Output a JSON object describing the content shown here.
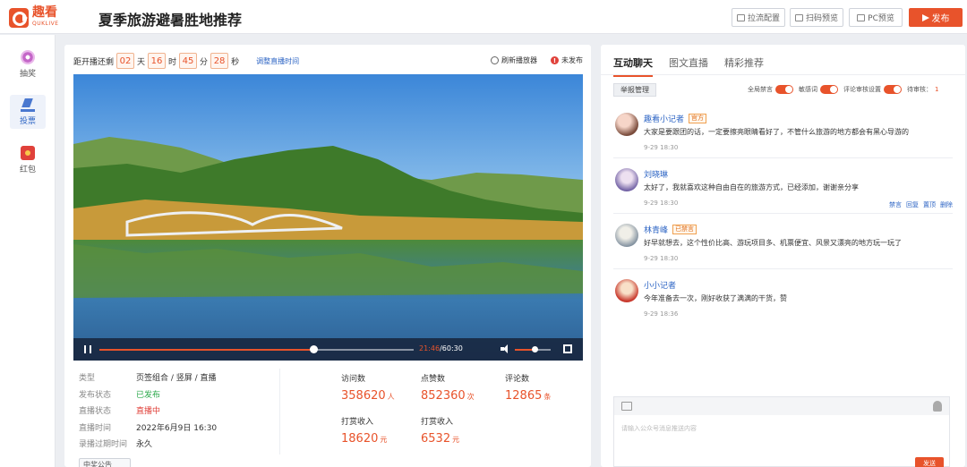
{
  "header": {
    "logo_cn": "趣看",
    "logo_en": "QUKLIVE",
    "title": "夏季旅游避暑胜地推荐",
    "btn_config": "拉流配置",
    "btn_scan": "扫码预览",
    "btn_pc": "PC预览",
    "btn_publish": "发布"
  },
  "sidebar": {
    "items": [
      {
        "label": "抽奖"
      },
      {
        "label": "投票"
      },
      {
        "label": "红包"
      }
    ]
  },
  "countdown": {
    "prefix": "距开播还剩",
    "days": "02",
    "days_unit": "天",
    "hours": "16",
    "hours_unit": "时",
    "minutes": "45",
    "minutes_unit": "分",
    "seconds": "28",
    "seconds_unit": "秒",
    "adjust": "调整直播时间"
  },
  "player_status": {
    "refresh": "刷新播放器",
    "unpublished": "未发布",
    "unpublished_mark": "!"
  },
  "player": {
    "current": "21:46",
    "total": "/60:30",
    "progress": 0.68,
    "volume": 0.55
  },
  "details": [
    {
      "k": "类型",
      "v": "页签组合 / 竖屏 / 直播"
    },
    {
      "k": "发布状态",
      "v": "已发布"
    },
    {
      "k": "直播状态",
      "v": "直播中"
    },
    {
      "k": "直播时间",
      "v": "2022年6月9日  16:30"
    },
    {
      "k": "录播过期时间",
      "v": "永久"
    }
  ],
  "stats": [
    {
      "label": "访问数",
      "num": "358620",
      "unit": "人"
    },
    {
      "label": "点赞数",
      "num": "852360",
      "unit": "次"
    },
    {
      "label": "评论数",
      "num": "12865",
      "unit": "条"
    },
    {
      "label": "打赏收入",
      "num": "18620",
      "unit": "元"
    },
    {
      "label": "打赏收入",
      "num": "6532",
      "unit": "元"
    }
  ],
  "slot_button": "中奖公告",
  "chat": {
    "tabs": [
      "互动聊天",
      "图文直播",
      "精彩推荐"
    ],
    "report": "举报管理",
    "toggles": [
      {
        "label": "全局禁言"
      },
      {
        "label": "敏感词"
      },
      {
        "label": "评论审核设置"
      }
    ],
    "pending_label": "待审核：",
    "pending_count": "1",
    "messages": [
      {
        "name": "趣看小记者",
        "tag": "官方",
        "text": "大家是要跟团的话，一定要擦亮眼睛看好了，不管什么旅游的地方都会有黑心导游的",
        "time": "9-29  18:30"
      },
      {
        "name": "刘晓琳",
        "tag": "",
        "text": "太好了，我就喜欢这种自由自在的旅游方式，已经添加，谢谢亲分享",
        "time": "9-29  18:30",
        "actions": [
          "禁言",
          "回复",
          "置顶",
          "删除"
        ]
      },
      {
        "name": "林青峰",
        "tag": "已禁言",
        "text": "好早就想去，这个性价比高、游玩项目多、机票便宜、风景又漂亮的地方玩一玩了",
        "time": "9-29  18:30"
      },
      {
        "name": "小小记者",
        "tag": "",
        "text": "今年准备去一次，刚好收获了满满的干货，赞",
        "time": "9-29  18:36"
      }
    ],
    "compose_placeholder": "请输入公众号消息推送内容",
    "send": "发送"
  }
}
